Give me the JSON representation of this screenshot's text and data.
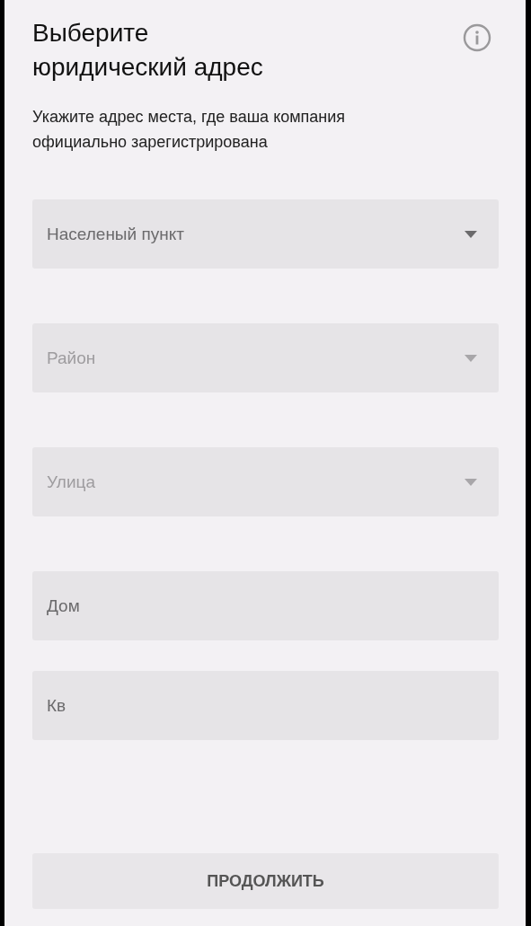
{
  "header": {
    "title": "Выберите юридический адрес",
    "subtitle": "Укажите адрес места, где ваша компания официально зарегистрирована"
  },
  "fields": [
    {
      "kind": "dropdown",
      "placeholder": "Населеный пункт",
      "disabled": false
    },
    {
      "kind": "dropdown",
      "placeholder": "Район",
      "disabled": true
    },
    {
      "kind": "dropdown",
      "placeholder": "Улица",
      "disabled": true
    },
    {
      "kind": "text",
      "placeholder": "Дом",
      "disabled": false
    },
    {
      "kind": "text",
      "placeholder": "Кв",
      "disabled": false
    }
  ],
  "continue_button": {
    "label": "ПРОДОЛЖИТЬ"
  }
}
